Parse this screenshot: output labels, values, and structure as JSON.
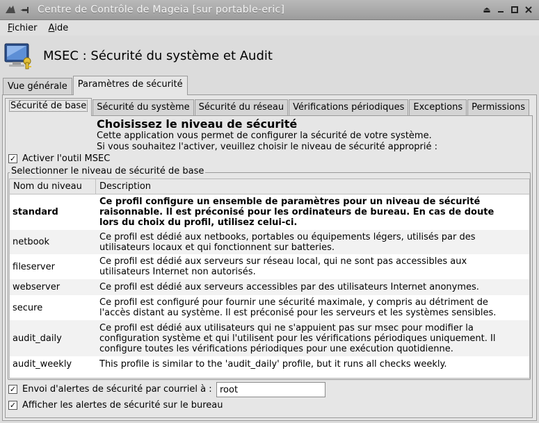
{
  "window": {
    "title": "Centre de Contrôle de Mageia  [sur portable-eric]"
  },
  "menu": [
    {
      "accel": "F",
      "rest": "ichier"
    },
    {
      "accel": "A",
      "rest": "ide"
    }
  ],
  "header": {
    "title": "MSEC : Sécurité du système et Audit"
  },
  "outer_tabs": [
    "Vue générale",
    "Paramètres de sécurité"
  ],
  "inner_tabs": [
    "Sécurité de base",
    "Sécurité du système",
    "Sécurité du réseau",
    "Vérifications périodiques",
    "Exceptions",
    "Permissions"
  ],
  "intro": {
    "heading": "Choisissez le niveau de sécurité",
    "line1": "Cette application vous permet de configurer la sécurité de votre système.",
    "line2": "Si vous souhaitez l'activer, veuillez choisir le niveau de sécurité approprié :"
  },
  "enable_msec": {
    "label": "Activer l'outil MSEC",
    "checked": true
  },
  "level_group": {
    "legend": "Selectionner le niveau de sécurité de base",
    "columns": [
      "Nom du niveau",
      "Description"
    ],
    "rows": [
      {
        "name": "standard",
        "desc": "Ce profil configure un ensemble de paramètres pour un niveau de sécurité raisonnable. Il est préconisé pour les ordinateurs de bureau. En cas de doute lors du choix du profil, utilisez celui-ci.",
        "selected": true
      },
      {
        "name": "netbook",
        "desc": "Ce profil est dédié aux netbooks, portables ou équipements légers, utilisés par des utilisateurs locaux et qui fonctionnent sur batteries.",
        "selected": false
      },
      {
        "name": "fileserver",
        "desc": "Ce profil est dédié aux serveurs sur réseau local, qui ne sont pas accessibles aux utilisateurs Internet non autorisés.",
        "selected": false
      },
      {
        "name": "webserver",
        "desc": "Ce profil est dédié aux serveurs accessibles par des utilisateurs Internet anonymes.",
        "selected": false
      },
      {
        "name": "secure",
        "desc": "Ce profil est configuré pour fournir une sécurité maximale, y compris au détriment de l'accès distant au système. Il est préconisé pour les serveurs et les systèmes sensibles.",
        "selected": false
      },
      {
        "name": "audit_daily",
        "desc": "Ce profil est dédié aux utilisateurs qui ne s'appuient pas sur msec pour modifier la configuration système et qui l'utilisent pour les vérifications périodiques uniquement. Il configure toutes les vérifications périodiques pour une exécution quotidienne.",
        "selected": false
      },
      {
        "name": "audit_weekly",
        "desc": "This profile is similar to the 'audit_daily' profile, but it runs all checks weekly.",
        "selected": false
      }
    ]
  },
  "email_alerts": {
    "label": "Envoi d'alertes de sécurité par courriel à :",
    "checked": true,
    "value": "root"
  },
  "desktop_alerts": {
    "label": "Afficher les alertes de sécurité sur le bureau",
    "checked": true
  }
}
